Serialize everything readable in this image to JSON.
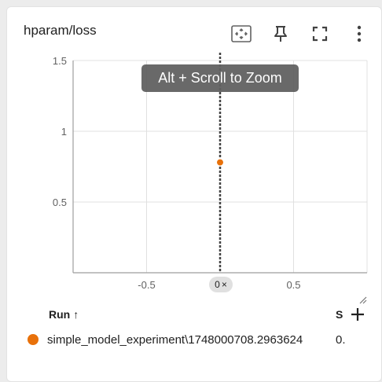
{
  "card": {
    "title": "hparam/loss",
    "tooltip": "Alt + Scroll to Zoom",
    "cursor_chip": {
      "value": "0",
      "close_glyph": "×"
    }
  },
  "toolbar": {
    "icons": [
      "fit-domain-icon",
      "pin-icon",
      "fullscreen-icon",
      "more-vert-icon"
    ]
  },
  "colors": {
    "series": "#e8710a",
    "cursor_line": "#424242",
    "grid": "#e0e0e0",
    "axis": "#9e9e9e"
  },
  "chart_data": {
    "type": "scatter",
    "x_ticks": [
      "-0.5",
      "0.5"
    ],
    "y_ticks": [
      "0.5",
      "1",
      "1.5"
    ],
    "xlim": [
      -1.0,
      1.0
    ],
    "ylim": [
      0,
      1.5
    ],
    "grid": true,
    "cursor_x": 0,
    "series": [
      {
        "name": "simple_model_experiment\\1748000708.2963624",
        "points": [
          {
            "x": 0,
            "y": 0.78
          }
        ]
      }
    ]
  },
  "table": {
    "run_header": "Run",
    "sort_glyph": "↑",
    "second_header": "S",
    "rows": [
      {
        "name": "simple_model_experiment\\1748000708.2963624",
        "value": "0."
      }
    ]
  }
}
